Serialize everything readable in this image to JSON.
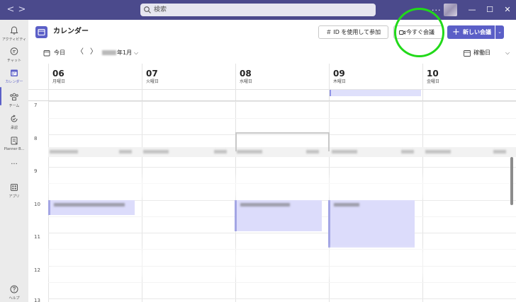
{
  "titlebar": {
    "search_placeholder": "検索",
    "more": "...",
    "min": "—",
    "max": "☐",
    "close": "✕",
    "back": "<",
    "forward": ">"
  },
  "rail": {
    "items": [
      {
        "label": "アクティビティ",
        "icon": "bell-icon"
      },
      {
        "label": "チャット",
        "icon": "chat-icon"
      },
      {
        "label": "カレンダー",
        "icon": "calendar-icon",
        "active": true
      },
      {
        "label": "チーム",
        "icon": "teams-icon"
      },
      {
        "label": "承認",
        "icon": "approval-icon"
      },
      {
        "label": "Planner B...",
        "icon": "planner-icon"
      },
      {
        "label": "...",
        "icon": "more-icon"
      },
      {
        "label": "アプリ",
        "icon": "apps-icon"
      },
      {
        "label": "ヘルプ",
        "icon": "help-icon"
      }
    ]
  },
  "header": {
    "title": "カレンダー",
    "join_label": "＃  ID を使用して参加",
    "meet_now_label": "今すぐ会議",
    "new_meeting_label": "新しい会議",
    "new_meeting_plus": "+",
    "new_meeting_drop": "⌄",
    "today_label": "今日",
    "prev": "〈",
    "next": "〉",
    "month_label": "年1月",
    "month_chevron": "⌵",
    "view_label": "稼働日",
    "view_chevron": "⌵"
  },
  "days": [
    {
      "num": "06",
      "name": "月曜日"
    },
    {
      "num": "07",
      "name": "火曜日"
    },
    {
      "num": "08",
      "name": "水曜日"
    },
    {
      "num": "09",
      "name": "木曜日"
    },
    {
      "num": "10",
      "name": "金曜日"
    }
  ],
  "hours": [
    "7",
    "8",
    "9",
    "10",
    "11",
    "12",
    "13"
  ],
  "colors": {
    "accent": "#5b5fc7",
    "titlebar": "#4b4a8c",
    "event": "#dcdcfb",
    "highlight": "#22d91a"
  }
}
